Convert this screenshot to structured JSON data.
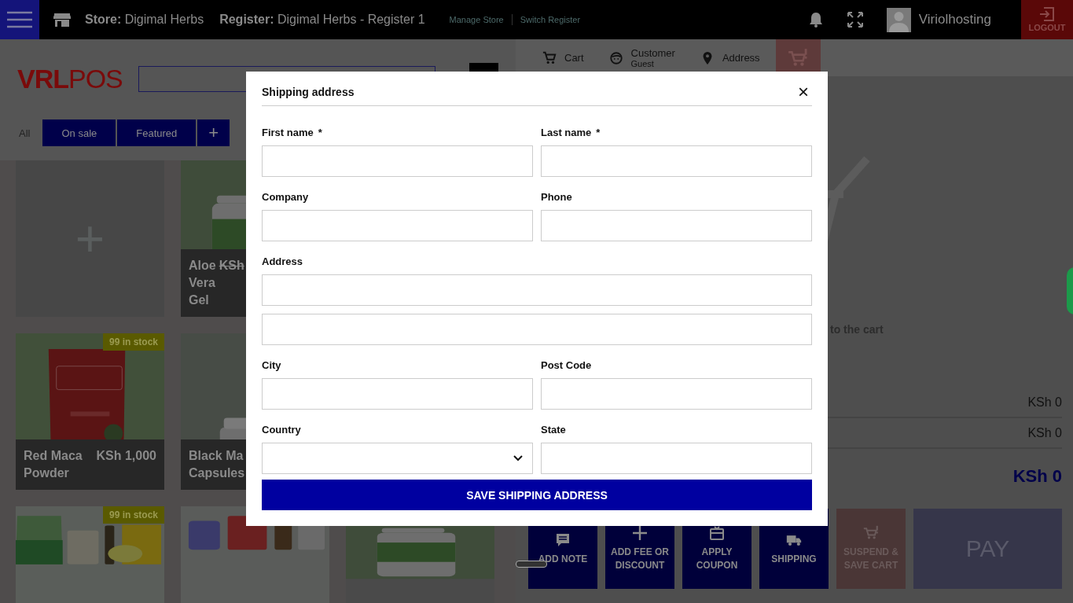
{
  "top_bar": {
    "store_label": "Store:",
    "store_name": "Digimal Herbs",
    "register_label": "Register:",
    "register_name": "Digimal Herbs - Register 1",
    "links": [
      "Manage Store",
      "Switch Register"
    ],
    "user_name": "Viriolhosting",
    "logout": "LOGOUT"
  },
  "logo": {
    "bold": "VRL",
    "light": "POS"
  },
  "categories": [
    {
      "label": "All",
      "selected": true
    },
    {
      "label": "On sale",
      "selected": false
    },
    {
      "label": "Featured",
      "selected": false
    },
    {
      "label": "+",
      "selected": false
    }
  ],
  "product_rows": [
    {
      "cards": [
        {
          "kind": "add",
          "label": "+"
        },
        {
          "kind": "product",
          "name": "Aloe Vera Gel",
          "price": "KSh",
          "on_sale": true
        }
      ]
    },
    {
      "cards": [
        {
          "kind": "product",
          "name": "Red Maca Powder",
          "price": "KSh 1,000",
          "on_sale": false,
          "stock": "99 in stock"
        },
        {
          "kind": "product",
          "name": "Black Ma Capsules"
        }
      ]
    },
    {
      "cards": [
        {
          "kind": "picture",
          "stock": "99 in stock"
        },
        {
          "kind": "picture"
        },
        {
          "kind": "picture"
        }
      ]
    }
  ],
  "cart_tabs": [
    {
      "kind": "cart",
      "label": "Cart"
    },
    {
      "kind": "customer",
      "label": "Customer",
      "sub": "Guest"
    },
    {
      "kind": "address",
      "label": "Address"
    }
  ],
  "empty_message": "to the cart",
  "totals": [
    "KSh 0",
    "KSh 0"
  ],
  "total": "KSh 0",
  "actions": [
    {
      "kind": "note",
      "label": "ADD NOTE"
    },
    {
      "kind": "fee",
      "label": "ADD FEE OR DISCOUNT"
    },
    {
      "kind": "coupon",
      "label": "APPLY COUPON"
    },
    {
      "kind": "shipping",
      "label": "SHIPPING"
    },
    {
      "kind": "suspend",
      "label": "SUSPEND & SAVE CART"
    }
  ],
  "pay": "PAY",
  "modal": {
    "title": "Shipping address",
    "close": "×",
    "fields": [
      {
        "kind": "text",
        "label": "First name",
        "marker": "*"
      },
      {
        "kind": "text",
        "label": "Last name",
        "marker": "*"
      },
      {
        "kind": "text",
        "label": "Company"
      },
      {
        "kind": "text",
        "label": "Phone"
      },
      {
        "kind": "text",
        "label": "Address",
        "wide": true
      },
      {
        "kind": "text",
        "wide": true
      },
      {
        "kind": "text",
        "label": "City"
      },
      {
        "kind": "text",
        "label": "Post Code"
      },
      {
        "kind": "select",
        "label": "Country"
      },
      {
        "kind": "text",
        "label": "State"
      }
    ],
    "submit": "SAVE SHIPPING ADDRESS"
  }
}
